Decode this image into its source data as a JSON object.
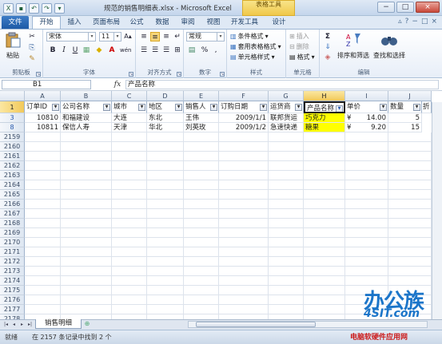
{
  "window": {
    "title": "规范的销售明细表.xlsx - Microsoft Excel",
    "contextual_tab_group": "表格工具",
    "minimize": "−",
    "maximize": "□",
    "close": "×"
  },
  "tabs": [
    "文件",
    "开始",
    "插入",
    "页面布局",
    "公式",
    "数据",
    "审阅",
    "视图",
    "开发工具",
    "设计"
  ],
  "ribbon": {
    "clipboard": {
      "label": "剪贴板",
      "paste": "粘贴"
    },
    "font": {
      "label": "字体",
      "font_name": "宋体",
      "font_size": "11"
    },
    "alignment": {
      "label": "对齐方式"
    },
    "number": {
      "label": "数字",
      "format": "常规",
      "percent": "%",
      "comma": ","
    },
    "styles": {
      "label": "样式",
      "items": [
        "条件格式",
        "套用表格格式",
        "单元格样式"
      ]
    },
    "cells": {
      "label": "单元格",
      "items": [
        "插入",
        "删除",
        "格式"
      ]
    },
    "editing": {
      "label": "编辑",
      "sigma": "Σ",
      "sort_filter": "排序和筛选",
      "find_select": "查找和选择"
    }
  },
  "formula_bar": {
    "name_box": "B1",
    "fx": "fx",
    "content": "产品名称"
  },
  "columns": [
    "A",
    "B",
    "C",
    "D",
    "E",
    "F",
    "G",
    "H",
    "I",
    "J"
  ],
  "selected_column": "H",
  "header_row": {
    "row_number": "1",
    "cells": [
      "订单ID",
      "公司名称",
      "城市",
      "地区",
      "销售人",
      "订购日期",
      "运货商",
      "产品名称",
      "单价",
      "数量"
    ],
    "overflow": "折"
  },
  "data_rows": [
    {
      "row_number": "3",
      "cells": [
        "10810",
        "和福建设",
        "大连",
        "东北",
        "王伟",
        "2009/1/1",
        "联邦货运",
        "巧克力",
        "¥",
        "14.00",
        "5"
      ]
    },
    {
      "row_number": "8",
      "cells": [
        "10811",
        "保信人寿",
        "天津",
        "华北",
        "刘英玫",
        "2009/1/2",
        "急速快递",
        "糖果",
        "¥",
        "9.20",
        "15"
      ]
    }
  ],
  "empty_rows": [
    "2159",
    "2160",
    "2161",
    "2162",
    "2163",
    "2164",
    "2165",
    "2166",
    "2167",
    "2168",
    "2169",
    "2170",
    "2171",
    "2172",
    "2173",
    "2174",
    "2175",
    "2176",
    "2177",
    "2178",
    "2179",
    "2180"
  ],
  "sheet": {
    "tab_name": "销售明细",
    "nav": [
      "|◂",
      "◂",
      "▸",
      "▸|"
    ]
  },
  "status": {
    "mode": "就绪",
    "filter_text": "在 2157 条记录中找到 2 个"
  },
  "watermark": {
    "line1": "办公族",
    "line2": "4SIT.com",
    "line3": "电脑软硬件应用网"
  },
  "colors": {
    "accent": "#1d5aa6",
    "highlight": "#ffff00",
    "selected_header": "#f2c95a"
  }
}
